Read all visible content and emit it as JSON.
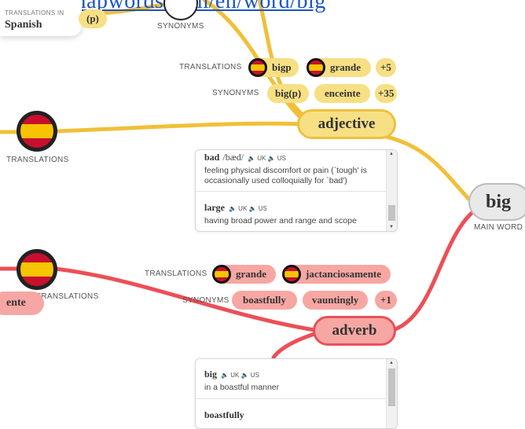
{
  "top_link": "https://mapwords.com/en/word/big",
  "lang_card": {
    "small_label": "TRANSLATIONS IN",
    "language": "Spanish"
  },
  "top_pill_partial": "(p)",
  "top_synonyms_label": "SYNONYMS",
  "main_word": {
    "word": "big",
    "label": "MAIN WORD"
  },
  "adjective": {
    "label": "adjective",
    "translations_label": "TRANSLATIONS",
    "translations": [
      "bigp",
      "grande"
    ],
    "translations_more": "+5",
    "synonyms_label": "SYNONYMS",
    "synonyms": [
      "big(p)",
      "enceinte"
    ],
    "synonyms_more": "+35",
    "left_translations_label": "TRANSLATIONS",
    "definitions": [
      {
        "word": "bad",
        "ipa": "/bæd/",
        "audio": "🔈 UK  🔈 US",
        "text": "feeling physical discomfort or pain (`tough' is occasionally used colloquially for `bad')"
      },
      {
        "word": "large",
        "audio": "🔈 UK  🔈 US",
        "text": "having broad power and range and scope"
      }
    ]
  },
  "adverb": {
    "label": "adverb",
    "translations_label": "TRANSLATIONS",
    "translations": [
      "grande",
      "jactanciosamente"
    ],
    "synonyms_label": "SYNONYMS",
    "synonyms": [
      "boastfully",
      "vauntingly"
    ],
    "synonyms_more": "+1",
    "left_translations_label": "TRANSLATIONS",
    "left_partial": "ente",
    "definitions": [
      {
        "word": "big",
        "audio": "🔈 UK  🔈 US",
        "text": "in a boastful manner"
      },
      {
        "word": "boastfully",
        "audio": "",
        "text": ""
      }
    ]
  },
  "colors": {
    "adjective_link": "#f0c038",
    "adverb_link": "#ec4f57",
    "link": "#1a55c8"
  }
}
